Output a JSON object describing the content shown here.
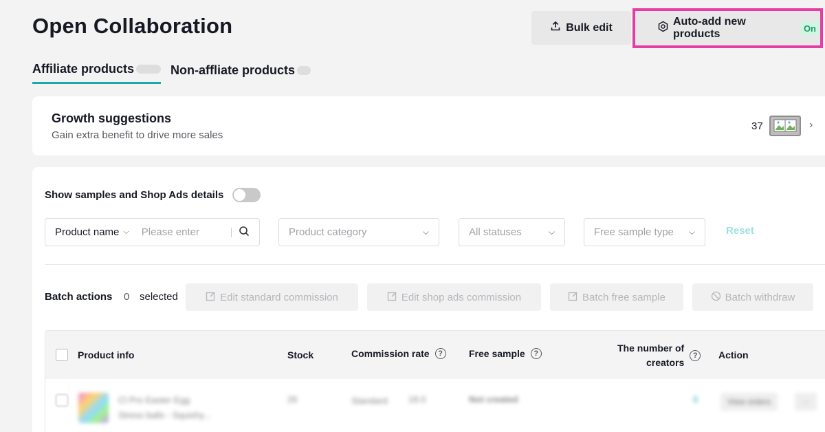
{
  "page": {
    "title": "Open Collaboration"
  },
  "header": {
    "bulk_edit_label": "Bulk edit",
    "auto_add_label": "Auto-add new products",
    "auto_add_status": "On"
  },
  "tabs": [
    {
      "label": "Affiliate products",
      "active": true
    },
    {
      "label": "Non-affliate products",
      "active": false
    }
  ],
  "growth": {
    "title": "Growth suggestions",
    "subtitle": "Gain extra benefit to drive more sales",
    "count": "37"
  },
  "toggle": {
    "label": "Show samples and Shop Ads details",
    "on": false
  },
  "filters": {
    "search_type": "Product name",
    "search_placeholder": "Please enter",
    "category_placeholder": "Product category",
    "status_placeholder": "All statuses",
    "sample_type_placeholder": "Free sample type",
    "reset_label": "Reset"
  },
  "batch": {
    "label": "Batch actions",
    "count": "0",
    "selected_label": "selected",
    "edit_standard": "Edit standard commission",
    "edit_shop_ads": "Edit shop ads commission",
    "batch_free_sample": "Batch free sample",
    "batch_withdraw": "Batch withdraw"
  },
  "table": {
    "columns": {
      "product_info": "Product info",
      "stock": "Stock",
      "commission_rate": "Commission rate",
      "free_sample": "Free sample",
      "creators_line1": "The number of",
      "creators_line2": "creators",
      "action": "Action"
    },
    "rows": [
      {
        "name_line1": "Cl Pro Easter Egg",
        "name_line2": "Stress balls - Squishy...",
        "stock": "26",
        "commission_label": "Standard",
        "commission_value": "18.0",
        "free_sample": "Not created",
        "creators": "0",
        "action": "View orders"
      }
    ]
  },
  "colors": {
    "accent_teal": "#1aa9a8",
    "highlight_pink": "#e63da5",
    "on_badge_green": "#1a9e62"
  }
}
